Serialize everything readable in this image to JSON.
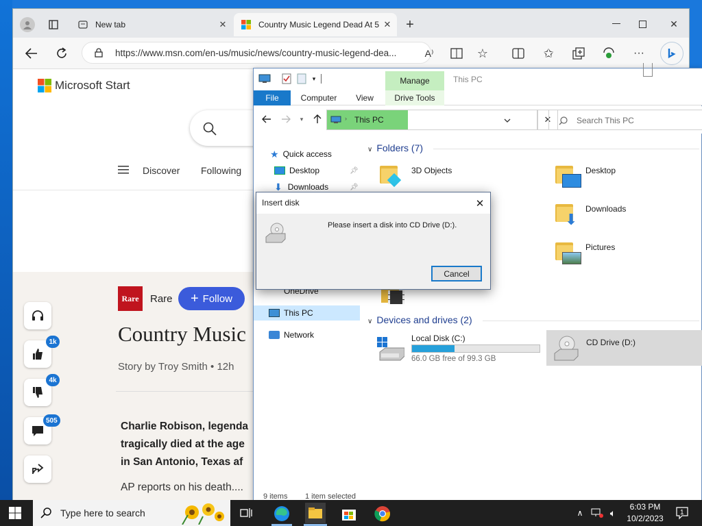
{
  "browser": {
    "tabs": [
      {
        "label": "New tab"
      },
      {
        "label": "Country Music Legend Dead At 5"
      }
    ],
    "url": "https://www.msn.com/en-us/music/news/country-music-legend-dea...",
    "new_tab_symbol": "+"
  },
  "msn": {
    "brand": "Microsoft Start",
    "nav": [
      "Discover",
      "Following"
    ],
    "publisher": "Rare",
    "publisher_logo_text": "Rare",
    "follow_label": "Follow",
    "headline": "Country Music",
    "byline": "Story by Troy Smith • 12h",
    "lead_lines": [
      "Charlie Robison, legenda",
      "tragically died at the age",
      "in San Antonio, Texas af"
    ],
    "body_line": "AP reports on his death....",
    "counts": {
      "likes": "1k",
      "dislikes": "4k",
      "comments": "505"
    }
  },
  "explorer": {
    "title_hint": "This PC",
    "ribbon_context": "Manage",
    "tabs": [
      "File",
      "Computer",
      "View",
      "Drive Tools"
    ],
    "breadcrumb": "This PC",
    "search_placeholder": "Search This PC",
    "tree": [
      {
        "label": "Quick access"
      },
      {
        "label": "Desktop"
      },
      {
        "label": "Downloads"
      },
      {
        "label": "OneDrive"
      },
      {
        "label": "This PC"
      },
      {
        "label": "Network"
      }
    ],
    "folders_heading": "Folders (7)",
    "folders": [
      {
        "label": "3D Objects"
      },
      {
        "label": "Desktop"
      },
      {
        "label": "Downloads"
      },
      {
        "label": "Pictures"
      }
    ],
    "devices_heading": "Devices and drives (2)",
    "drives": [
      {
        "label": "Local Disk (C:)",
        "free_text": "66.0 GB free of 99.3 GB",
        "used_fraction": 0.335
      },
      {
        "label": "CD Drive (D:)"
      }
    ],
    "status_items": "9 items",
    "status_selected": "1 item selected"
  },
  "dialog": {
    "title": "Insert disk",
    "message": "Please insert a disk into CD Drive (D:).",
    "cancel_label": "Cancel"
  },
  "taskbar": {
    "search_placeholder": "Type here to search",
    "time": "6:03 PM",
    "date": "10/2/2023",
    "notification_count": "1"
  },
  "colors": {
    "accent": "#1b74d2",
    "follow_button": "#3b5bdb",
    "manage_tab": "#c5eec0",
    "file_tab": "#1979ca",
    "drive_bar": "#26a0da"
  }
}
